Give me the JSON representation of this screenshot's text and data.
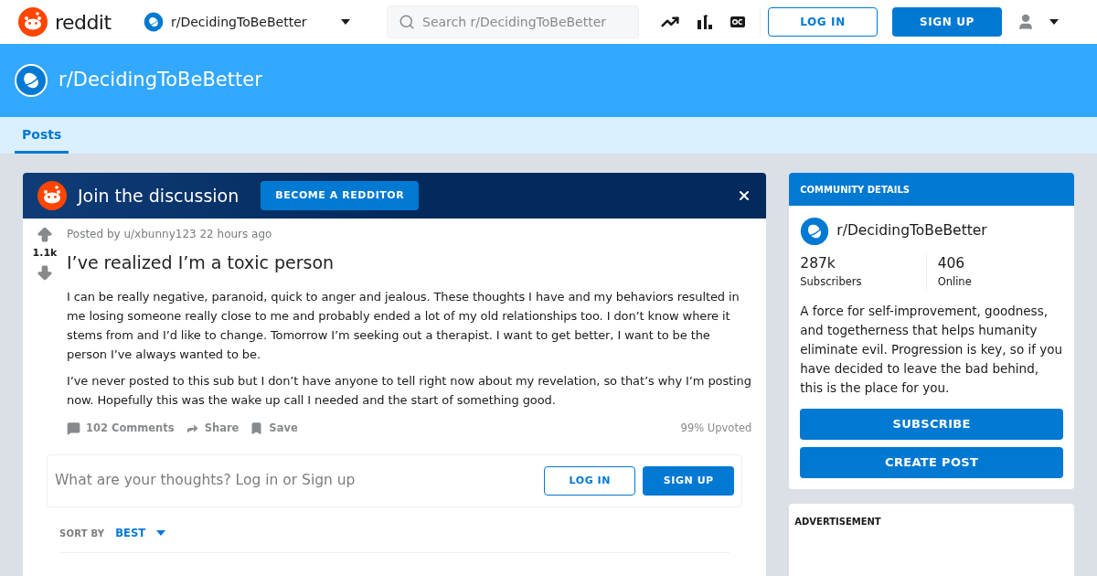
{
  "header": {
    "logo_text": "reddit",
    "community": "r/DecidingToBeBetter",
    "search": {
      "placeholder": "Search r/DecidingToBeBetter"
    },
    "buttons": [
      "LOG IN",
      "SIGN UP"
    ]
  },
  "banner": {
    "title": "r/DecidingToBeBetter"
  },
  "tabs": [
    {
      "label": "Posts",
      "selected": true
    }
  ],
  "join": {
    "title": "Join the discussion",
    "button": "BECOME A REDDITOR"
  },
  "post": {
    "votes": "1.1k",
    "meta": "Posted by u/xbunny123 22 hours ago",
    "title": "I’ve realized I’m a toxic person",
    "paragraphs": [
      "I can be really negative, paranoid, quick to anger and jealous. These thoughts I have and my behaviors resulted in me losing someone really close to me and probably ended a lot of my old relationships too. I don’t know where it stems from and I’d like to change. Tomorrow I’m seeking out a therapist. I want to get better, I want to be the person I’ve always wanted to be.",
      "I’ve never posted to this sub but I don’t have anyone to tell right now about my revelation, so that’s why I’m posting now. Hopefully this was the wake up call I needed and the start of something good."
    ],
    "actions": [
      {
        "kind": "comments",
        "label": "102 Comments"
      },
      {
        "kind": "share",
        "label": "Share"
      },
      {
        "kind": "save",
        "label": "Save"
      }
    ],
    "upvoted": "99% Upvoted"
  },
  "comment_box": {
    "prompt": "What are your thoughts? Log in or Sign up",
    "buttons": [
      "LOG IN",
      "SIGN UP"
    ]
  },
  "sort": {
    "label": "SORT BY",
    "value": "BEST"
  },
  "sidebar": {
    "heading": "COMMUNITY DETAILS",
    "name": "r/DecidingToBeBetter",
    "stats": [
      {
        "value": "287k",
        "label": "Subscribers"
      },
      {
        "value": "406",
        "label": "Online"
      }
    ],
    "description": "A force for self-improvement, goodness, and togetherness that helps humanity eliminate evil. Progression is key, so if you have decided to leave the bad behind, this is the place for you.",
    "buttons": [
      "SUBSCRIBE",
      "CREATE POST"
    ],
    "ad_label": "ADVERTISEMENT"
  }
}
